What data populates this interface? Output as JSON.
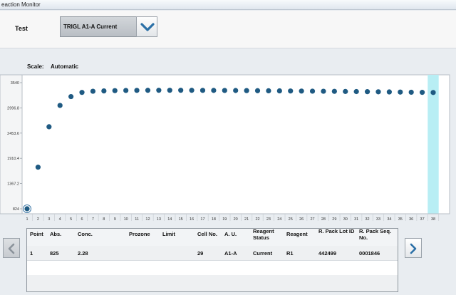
{
  "window": {
    "title": "eaction Monitor"
  },
  "test": {
    "label": "Test",
    "selected": "TRIGL A1-A Current"
  },
  "scale": {
    "label": "Scale:",
    "value": "Automatic"
  },
  "colors": {
    "point": "#1f5a82",
    "highlight": "#b8eef4",
    "accent": "#2a6fa6"
  },
  "chart_data": {
    "type": "scatter",
    "title": "",
    "xlabel": "",
    "ylabel": "",
    "x": [
      1,
      2,
      3,
      4,
      5,
      6,
      7,
      8,
      9,
      10,
      11,
      12,
      13,
      14,
      15,
      16,
      17,
      18,
      19,
      20,
      21,
      22,
      23,
      24,
      25,
      26,
      27,
      28,
      29,
      30,
      31,
      32,
      33,
      34,
      35,
      36,
      37,
      38
    ],
    "values": [
      824,
      1720,
      2590,
      3050,
      3240,
      3330,
      3355,
      3362,
      3368,
      3372,
      3374,
      3375,
      3376,
      3376,
      3376,
      3375,
      3374,
      3373,
      3372,
      3371,
      3369,
      3367,
      3365,
      3363,
      3361,
      3359,
      3357,
      3355,
      3353,
      3350,
      3348,
      3346,
      3343,
      3340,
      3337,
      3334,
      3331,
      3328
    ],
    "yticks": [
      "824",
      "1367.2",
      "1910.4",
      "2453.6",
      "2996.8",
      "3540"
    ],
    "ylim": [
      824,
      3540
    ],
    "xlim": [
      1,
      38
    ],
    "selected_point": 1,
    "highlighted_x": 38,
    "grid": false
  },
  "table": {
    "headers": [
      "Point",
      "Abs.",
      "Conc.",
      "Prozone",
      "Limit",
      "Cell No.",
      "A. U.",
      "Reagent Status",
      "Reagent",
      "R. Pack Lot ID",
      "R. Pack Seq. No."
    ],
    "rows": [
      [
        "1",
        "825",
        "2.28",
        "",
        "",
        "29",
        "A1-A",
        "Current",
        "R1",
        "442499",
        "0001846"
      ]
    ]
  }
}
